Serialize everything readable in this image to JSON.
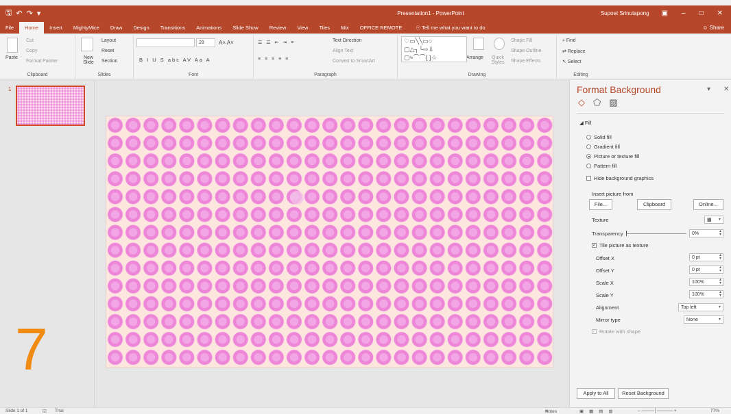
{
  "titlebar": {
    "title": "Presentation1 - PowerPoint",
    "user": "Supoet Srinutapong"
  },
  "tabs": [
    "File",
    "Home",
    "Insert",
    "MightyMice",
    "Draw",
    "Design",
    "Transitions",
    "Animations",
    "Slide Show",
    "Review",
    "View",
    "Tiles",
    "Mix",
    "OFFICE REMOTE"
  ],
  "tell_me": "Tell me what you want to do",
  "share": "Share",
  "ribbon": {
    "clipboard": {
      "paste": "Paste",
      "cut": "Cut",
      "copy": "Copy",
      "format_painter": "Format Painter",
      "label": "Clipboard"
    },
    "slides": {
      "new_slide": "New Slide",
      "layout": "Layout",
      "reset": "Reset",
      "section": "Section",
      "label": "Slides"
    },
    "font": {
      "size": "28",
      "label": "Font"
    },
    "paragraph": {
      "text_direction": "Text Direction",
      "align_text": "Align Text",
      "convert": "Convert to SmartArt",
      "label": "Paragraph"
    },
    "drawing": {
      "arrange": "Arrange",
      "quick_styles": "Quick Styles",
      "shape_fill": "Shape Fill",
      "shape_outline": "Shape Outline",
      "shape_effects": "Shape Effects",
      "label": "Drawing"
    },
    "editing": {
      "find": "Find",
      "replace": "Replace",
      "select": "Select",
      "label": "Editing"
    }
  },
  "slides_panel": {
    "number": "1"
  },
  "overlay_number": "7",
  "format_panel": {
    "title": "Format Background",
    "section": "Fill",
    "solid_fill": "Solid fill",
    "gradient_fill": "Gradient fill",
    "picture_fill": "Picture or texture fill",
    "pattern_fill": "Pattern fill",
    "hide_graphics": "Hide background graphics",
    "insert_from": "Insert picture from",
    "file_btn": "File...",
    "clipboard_btn": "Clipboard",
    "online_btn": "Online...",
    "texture": "Texture",
    "transparency": "Transparency",
    "transparency_val": "0%",
    "tile": "Tile picture as texture",
    "offset_x": "Offset X",
    "offset_x_val": "0 pt",
    "offset_y": "Offset Y",
    "offset_y_val": "0 pt",
    "scale_x": "Scale X",
    "scale_x_val": "100%",
    "scale_y": "Scale Y",
    "scale_y_val": "100%",
    "alignment": "Alignment",
    "alignment_val": "Top left",
    "mirror": "Mirror type",
    "mirror_val": "None",
    "rotate": "Rotate with shape",
    "apply_all": "Apply to All",
    "reset_bg": "Reset Background"
  },
  "status": {
    "slide": "Slide 1 of 1",
    "lang": "Thai",
    "notes": "Notes",
    "zoom": "77%"
  },
  "colors": {
    "accent": "#b7472a",
    "pattern_pink": "#ee86d8",
    "slide_bg": "#fde6de",
    "number": "#f08a10"
  }
}
